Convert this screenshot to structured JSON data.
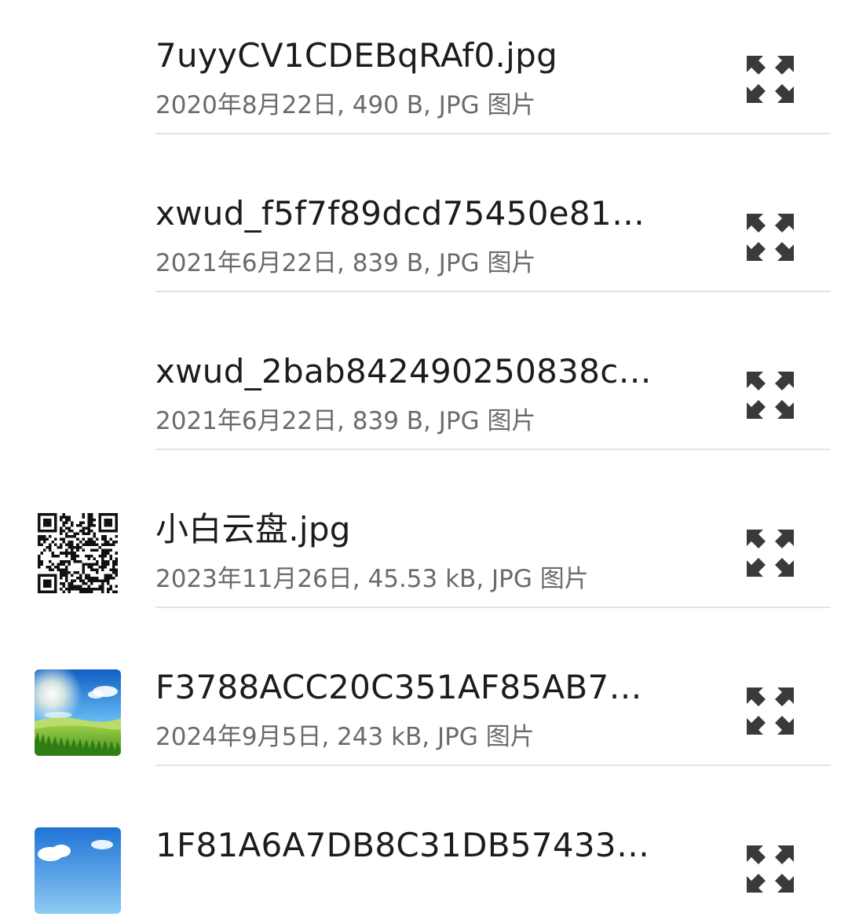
{
  "files": [
    {
      "name": "7uyyCV1CDEBqRAf0.jpg",
      "meta": "2020年8月22日, 490 B, JPG 图片",
      "thumbnail": "none",
      "action_icon": "expand-icon"
    },
    {
      "name": "xwud_f5f7f89dcd75450e814…",
      "meta": "2021年6月22日, 839 B, JPG 图片",
      "thumbnail": "none",
      "action_icon": "expand-icon"
    },
    {
      "name": "xwud_2bab842490250838ca…",
      "meta": "2021年6月22日, 839 B, JPG 图片",
      "thumbnail": "none",
      "action_icon": "expand-icon"
    },
    {
      "name": "小白云盘.jpg",
      "meta": "2023年11月26日, 45.53 kB, JPG 图片",
      "thumbnail": "qr-code-image",
      "action_icon": "expand-icon"
    },
    {
      "name": "F3788ACC20C351AF85AB72…",
      "meta": "2024年9月5日, 243 kB, JPG 图片",
      "thumbnail": "landscape-image",
      "action_icon": "expand-icon"
    },
    {
      "name": "1F81A6A7DB8C31DB57433D…",
      "meta": "",
      "thumbnail": "landscape-image",
      "action_icon": "expand-icon"
    }
  ],
  "colors": {
    "name_text": "#1c1c1c",
    "meta_text": "#6b6b6b",
    "divider": "#e3e3e3",
    "icon": "#3a3a3a"
  }
}
